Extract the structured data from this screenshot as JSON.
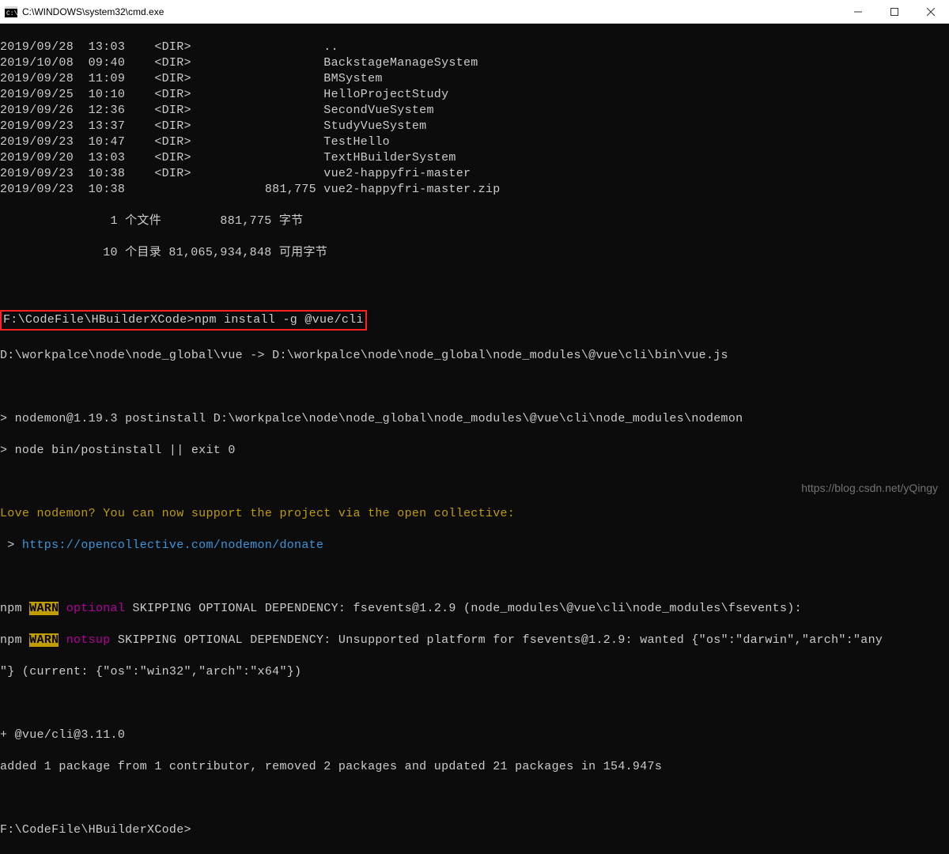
{
  "window": {
    "title": "C:\\WINDOWS\\system32\\cmd.exe"
  },
  "dir_listing": [
    {
      "date": "2019/09/28",
      "time": "13:03",
      "tag": "<DIR>",
      "size": "",
      "name": ".."
    },
    {
      "date": "2019/10/08",
      "time": "09:40",
      "tag": "<DIR>",
      "size": "",
      "name": "BackstageManageSystem"
    },
    {
      "date": "2019/09/28",
      "time": "11:09",
      "tag": "<DIR>",
      "size": "",
      "name": "BMSystem"
    },
    {
      "date": "2019/09/25",
      "time": "10:10",
      "tag": "<DIR>",
      "size": "",
      "name": "HelloProjectStudy"
    },
    {
      "date": "2019/09/26",
      "time": "12:36",
      "tag": "<DIR>",
      "size": "",
      "name": "SecondVueSystem"
    },
    {
      "date": "2019/09/23",
      "time": "13:37",
      "tag": "<DIR>",
      "size": "",
      "name": "StudyVueSystem"
    },
    {
      "date": "2019/09/23",
      "time": "10:47",
      "tag": "<DIR>",
      "size": "",
      "name": "TestHello"
    },
    {
      "date": "2019/09/20",
      "time": "13:03",
      "tag": "<DIR>",
      "size": "",
      "name": "TextHBuilderSystem"
    },
    {
      "date": "2019/09/23",
      "time": "10:38",
      "tag": "<DIR>",
      "size": "",
      "name": "vue2-happyfri-master"
    },
    {
      "date": "2019/09/23",
      "time": "10:38",
      "tag": "",
      "size": "881,775",
      "name": "vue2-happyfri-master.zip"
    }
  ],
  "summary": {
    "files_line": "               1 个文件        881,775 字节",
    "dirs_line": "              10 个目录 81,065,934,848 可用字节"
  },
  "cmd": {
    "prompt_path": "F:\\CodeFile\\HBuilderXCode>",
    "command": "npm install -g @vue/cli"
  },
  "link_line": "D:\\workpalce\\node\\node_global\\vue -> D:\\workpalce\\node\\node_global\\node_modules\\@vue\\cli\\bin\\vue.js",
  "post": {
    "line1": "> nodemon@1.19.3 postinstall D:\\workpalce\\node\\node_global\\node_modules\\@vue\\cli\\node_modules\\nodemon",
    "line2": "> node bin/postinstall || exit 0"
  },
  "love": {
    "msg": "Love nodemon? You can now support the project via the open collective:",
    "arrow": " > ",
    "url": "https://opencollective.com/nodemon/donate"
  },
  "warn1": {
    "prefix": "npm ",
    "tag": "WARN",
    "kind": " optional",
    "rest": " SKIPPING OPTIONAL DEPENDENCY: fsevents@1.2.9 (node_modules\\@vue\\cli\\node_modules\\fsevents):"
  },
  "warn2": {
    "prefix": "npm ",
    "tag": "WARN",
    "kind": " notsup",
    "rest1": " SKIPPING OPTIONAL DEPENDENCY: Unsupported platform for fsevents@1.2.9: wanted {\"os\":\"darwin\",\"arch\":\"any",
    "rest2": "\"} (current: {\"os\":\"win32\",\"arch\":\"x64\"})"
  },
  "result": {
    "pkg": "+ @vue/cli@3.11.0",
    "summary": "added 1 package from 1 contributor, removed 2 packages and updated 21 packages in 154.947s"
  },
  "final_prompt": "F:\\CodeFile\\HBuilderXCode>",
  "watermark": "https://blog.csdn.net/yQingy"
}
